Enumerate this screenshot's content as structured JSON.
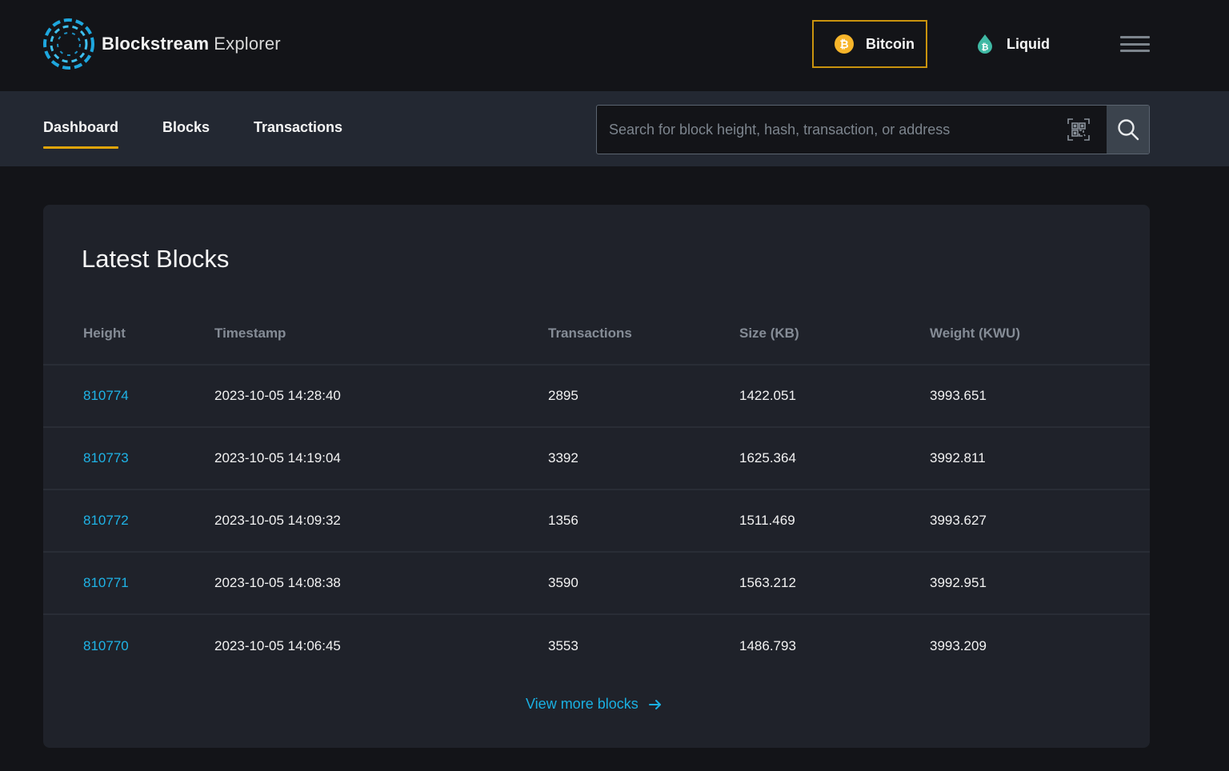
{
  "app": {
    "logo_bold": "Blockstream",
    "logo_light": "Explorer"
  },
  "networks": [
    {
      "label": "Bitcoin",
      "icon": "bitcoin-icon",
      "active": true,
      "color": "#f7b52a"
    },
    {
      "label": "Liquid",
      "icon": "liquid-drop-icon",
      "active": false,
      "color": "#3fb9a4"
    }
  ],
  "colors": {
    "accent": "#e0a50b",
    "link": "#1fb3e6",
    "background": "#131418",
    "card": "#1f222a"
  },
  "nav": {
    "tabs": [
      {
        "label": "Dashboard",
        "active": true
      },
      {
        "label": "Blocks",
        "active": false
      },
      {
        "label": "Transactions",
        "active": false
      }
    ]
  },
  "search": {
    "value": "",
    "placeholder": "Search for block height, hash, transaction, or address"
  },
  "latest_blocks": {
    "title": "Latest Blocks",
    "columns": [
      "Height",
      "Timestamp",
      "Transactions",
      "Size (KB)",
      "Weight (KWU)"
    ],
    "rows": [
      {
        "height": "810774",
        "timestamp": "2023-10-05 14:28:40",
        "transactions": "2895",
        "size": "1422.051",
        "weight": "3993.651"
      },
      {
        "height": "810773",
        "timestamp": "2023-10-05 14:19:04",
        "transactions": "3392",
        "size": "1625.364",
        "weight": "3992.811"
      },
      {
        "height": "810772",
        "timestamp": "2023-10-05 14:09:32",
        "transactions": "1356",
        "size": "1511.469",
        "weight": "3993.627"
      },
      {
        "height": "810771",
        "timestamp": "2023-10-05 14:08:38",
        "transactions": "3590",
        "size": "1563.212",
        "weight": "3992.951"
      },
      {
        "height": "810770",
        "timestamp": "2023-10-05 14:06:45",
        "transactions": "3553",
        "size": "1486.793",
        "weight": "3993.209"
      }
    ],
    "view_more_label": "View more blocks"
  }
}
